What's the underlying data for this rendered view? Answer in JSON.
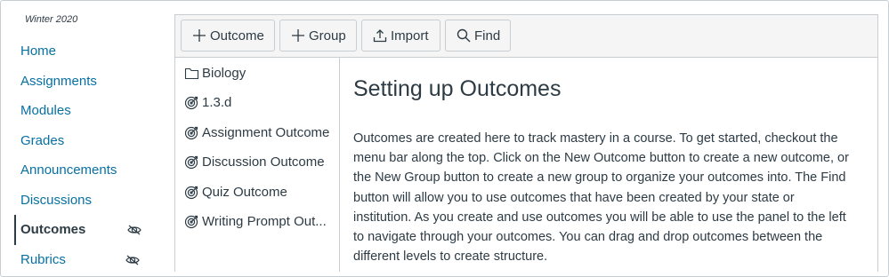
{
  "course": {
    "term": "Winter 2020"
  },
  "nav": {
    "items": [
      {
        "label": "Home",
        "active": false,
        "hidden_from_students": false
      },
      {
        "label": "Assignments",
        "active": false,
        "hidden_from_students": false
      },
      {
        "label": "Modules",
        "active": false,
        "hidden_from_students": false
      },
      {
        "label": "Grades",
        "active": false,
        "hidden_from_students": false
      },
      {
        "label": "Announcements",
        "active": false,
        "hidden_from_students": false
      },
      {
        "label": "Discussions",
        "active": false,
        "hidden_from_students": false
      },
      {
        "label": "Outcomes",
        "active": true,
        "hidden_from_students": true
      },
      {
        "label": "Rubrics",
        "active": false,
        "hidden_from_students": true
      }
    ]
  },
  "toolbar": {
    "outcome_label": "Outcome",
    "group_label": "Group",
    "import_label": "Import",
    "find_label": "Find"
  },
  "tree": {
    "items": [
      {
        "label": "Biology",
        "icon": "folder-icon"
      },
      {
        "label": "1.3.d",
        "icon": "outcome-target-icon"
      },
      {
        "label": "Assignment Outcome",
        "icon": "outcome-target-icon"
      },
      {
        "label": "Discussion Outcome",
        "icon": "outcome-target-icon"
      },
      {
        "label": "Quiz Outcome",
        "icon": "outcome-target-icon"
      },
      {
        "label": "Writing Prompt Out...",
        "icon": "outcome-target-icon"
      }
    ]
  },
  "content": {
    "title": "Setting up Outcomes",
    "body": "Outcomes are created here to track mastery in a course. To get started, checkout the menu bar along the top. Click on the New Outcome button to create a new outcome, or the New Group button to create a new group to organize your outcomes into. The Find button will allow you to use outcomes that have been created by your state or institution. As you create and use outcomes you will be able to use the panel to the left to navigate through your outcomes. You can drag and drop outcomes between the different levels to create structure."
  },
  "colors": {
    "link": "#0770a3",
    "text": "#2d3b45",
    "border": "#c7cdd1",
    "toolbar_bg": "#f5f5f5"
  }
}
